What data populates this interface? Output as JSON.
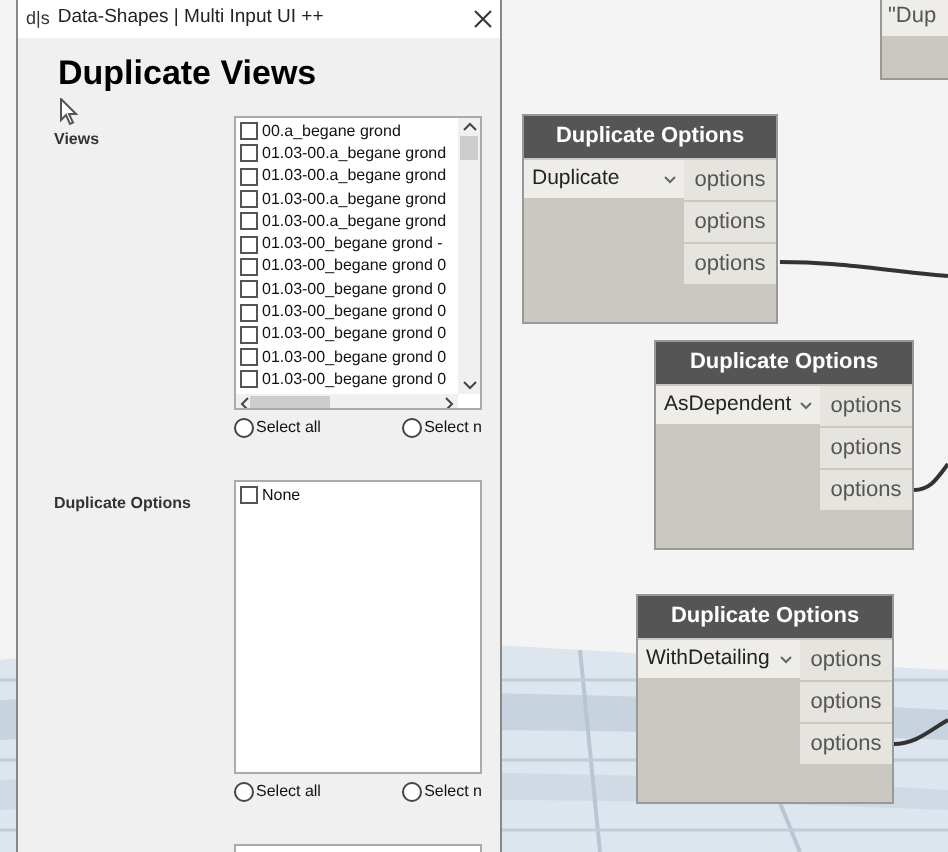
{
  "window": {
    "logo": "d|s",
    "title": "Data-Shapes | Multi Input UI ++"
  },
  "heading": "Duplicate Views",
  "fields": [
    {
      "kind": "checklist",
      "label": "Views",
      "scrollbars": true,
      "items": [
        {
          "text": "00.a_begane grond",
          "checked": false
        },
        {
          "text": "01.03-00.a_begane grond",
          "checked": false
        },
        {
          "text": "01.03-00.a_begane grond",
          "checked": false
        },
        {
          "text": "01.03-00.a_begane grond",
          "checked": false
        },
        {
          "text": "01.03-00.a_begane grond",
          "checked": false
        },
        {
          "text": "01.03-00_begane grond -",
          "checked": false
        },
        {
          "text": "01.03-00_begane grond 0",
          "checked": false
        },
        {
          "text": "01.03-00_begane grond 0",
          "checked": false
        },
        {
          "text": "01.03-00_begane grond 0",
          "checked": false
        },
        {
          "text": "01.03-00_begane grond 0",
          "checked": false
        },
        {
          "text": "01.03-00_begane grond 0",
          "checked": false
        },
        {
          "text": "01.03-00_begane grond 0",
          "checked": false
        }
      ],
      "radios": [
        {
          "label": "Select all",
          "selected": false
        },
        {
          "label": "Select n",
          "selected": false
        }
      ]
    },
    {
      "kind": "checklist",
      "label": "Duplicate Options",
      "scrollbars": false,
      "items": [
        {
          "text": "None",
          "checked": false
        }
      ],
      "radios": [
        {
          "label": "Select all",
          "selected": false
        },
        {
          "label": "Select n",
          "selected": false
        }
      ]
    },
    {
      "kind": "text"
    }
  ],
  "partial_node": {
    "text": "\"Dup"
  },
  "nodes": [
    {
      "title": "Duplicate Options",
      "value": "Duplicate",
      "ports": [
        "options",
        "options",
        "options"
      ]
    },
    {
      "title": "Duplicate Options",
      "value": "AsDependent",
      "ports": [
        "options",
        "options",
        "options"
      ]
    },
    {
      "title": "Duplicate Options",
      "value": "WithDetailing",
      "ports": [
        "options",
        "options",
        "options"
      ]
    }
  ]
}
